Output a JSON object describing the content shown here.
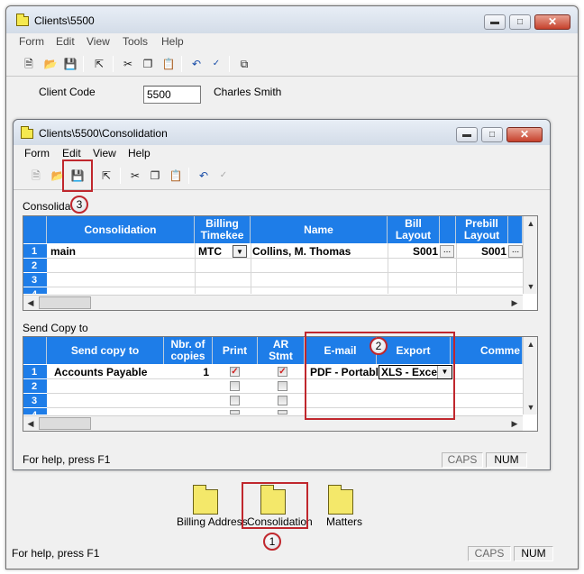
{
  "outer": {
    "title": "Clients\\5500",
    "menu": [
      "Form",
      "Edit",
      "View",
      "Tools",
      "Help"
    ],
    "client_code_label": "Client Code",
    "client_code_value": "5500",
    "client_name": "Charles Smith",
    "status_help": "For help, press F1",
    "status_caps": "CAPS",
    "status_num": "NUM"
  },
  "inner": {
    "title": "Clients\\5500\\Consolidation",
    "menu": [
      "Form",
      "Edit",
      "View",
      "Help"
    ],
    "consolidation_label": "Consolidati",
    "send_copy_label": "Send Copy to",
    "status_help": "For help, press F1",
    "status_caps": "CAPS",
    "status_num": "NUM"
  },
  "consolidation_grid": {
    "headers": [
      "Consolidation",
      "Billing\nTimekee",
      "Name",
      "Bill\nLayout",
      "Prebill\nLayout"
    ],
    "row_numbers": [
      "1",
      "2",
      "3",
      "4"
    ],
    "rows": [
      {
        "consolidation": "main",
        "billing_timekeeper": "MTC",
        "name": "Collins, M. Thomas",
        "bill_layout": "S001",
        "prebill_layout": "S001"
      }
    ]
  },
  "send_copy_grid": {
    "headers": [
      "Send copy to",
      "Nbr. of\ncopies",
      "Print",
      "AR\nStmt",
      "E-mail",
      "Export",
      "Comme"
    ],
    "row_numbers": [
      "1",
      "2",
      "3",
      "4"
    ],
    "rows": [
      {
        "send_copy_to": "Accounts Payable",
        "copies": "1",
        "print": true,
        "ar_stmt": true,
        "email": "PDF - Portabl",
        "export": "XLS - Exce"
      }
    ]
  },
  "bottom_icons": [
    "Billing Address",
    "Consolidation",
    "Matters"
  ],
  "callouts": [
    "1",
    "2",
    "3"
  ],
  "colors": {
    "grid_header": "#1e7de8",
    "callout": "#c0272d",
    "folder": "#f4e86a"
  },
  "toolbar_icons": [
    "new-icon",
    "open-icon",
    "save-icon",
    "up-folder-icon",
    "cut-icon",
    "copy-icon",
    "paste-icon",
    "undo-icon",
    "spellcheck-icon",
    "windows-icon"
  ]
}
